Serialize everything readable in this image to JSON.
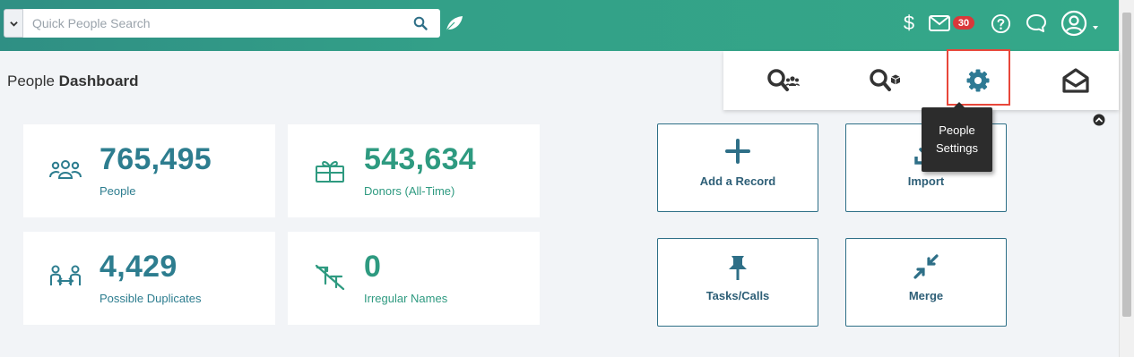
{
  "search": {
    "placeholder": "Quick People Search"
  },
  "header": {
    "mail_badge": "30",
    "dollar_glyph": "$",
    "icons": [
      "chevron-down-icon",
      "search-icon",
      "leaf-icon",
      "dollar-icon",
      "mail-icon",
      "help-icon",
      "chat-icon",
      "user-icon"
    ]
  },
  "page": {
    "title_light": "People",
    "title_bold": "Dashboard"
  },
  "quick_actions": {
    "items": [
      "search-people-icon",
      "search-packages-icon",
      "gear-icon",
      "open-mail-icon"
    ],
    "tooltip_line1": "People",
    "tooltip_line2": "Settings"
  },
  "stats": [
    {
      "value": "765,495",
      "label": "People",
      "icon": "people-group-icon"
    },
    {
      "value": "543,634",
      "label": "Donors (All-Time)",
      "icon": "gift-icon"
    },
    {
      "value": "4,429",
      "label": "Possible Duplicates",
      "icon": "duplicates-icon"
    },
    {
      "value": "0",
      "label": "Irregular Names",
      "icon": "irregular-names-icon"
    }
  ],
  "actions": [
    {
      "label": "Add a Record",
      "icon": "plus-icon"
    },
    {
      "label": "Import",
      "icon": "import-icon"
    },
    {
      "label": "Tasks/Calls",
      "icon": "pin-icon"
    },
    {
      "label": "Merge",
      "icon": "merge-icon"
    }
  ],
  "colors": {
    "brand": "#34a889",
    "stat_dark": "#2d7d8f",
    "stat_green": "#2e9a80",
    "highlight": "#e8473a"
  }
}
